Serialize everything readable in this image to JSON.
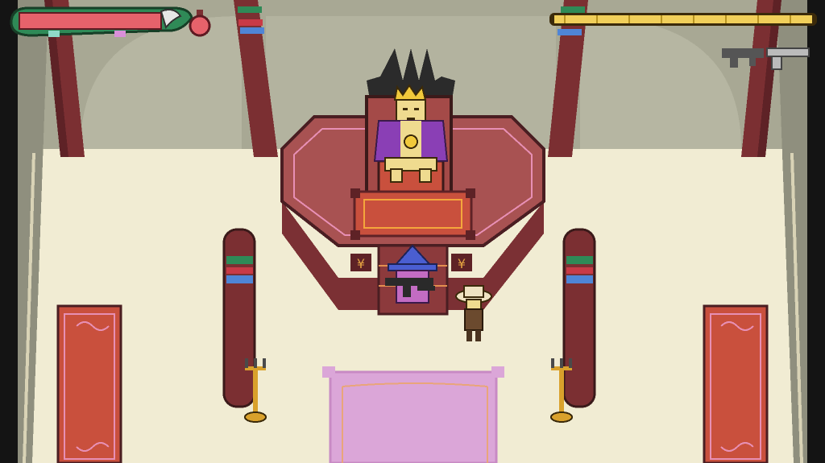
{
  "game": {
    "scene": "throne-room",
    "hud": {
      "health_fraction": 1.0,
      "potion_count": 1,
      "ammo_fraction": 1.0,
      "weapons": [
        "assault-rifle-icon",
        "revolver-icon"
      ]
    },
    "colors": {
      "floor": "#f1ecd3",
      "wall": "#a5a592",
      "pillar": "#7b2f32",
      "throne_platform": "#a85252",
      "carpet_pink": "#dba6d8",
      "health_red": "#e6626b",
      "serpent_green": "#2f8a57",
      "ammo_gold": "#f1cf5a",
      "king_robe": "#8a3fb5",
      "witch_hat": "#4a5ed1"
    },
    "characters": [
      {
        "name": "king-on-throne",
        "role": "boss"
      },
      {
        "name": "witch-player",
        "role": "player"
      },
      {
        "name": "explorer-companion",
        "role": "npc"
      }
    ]
  }
}
